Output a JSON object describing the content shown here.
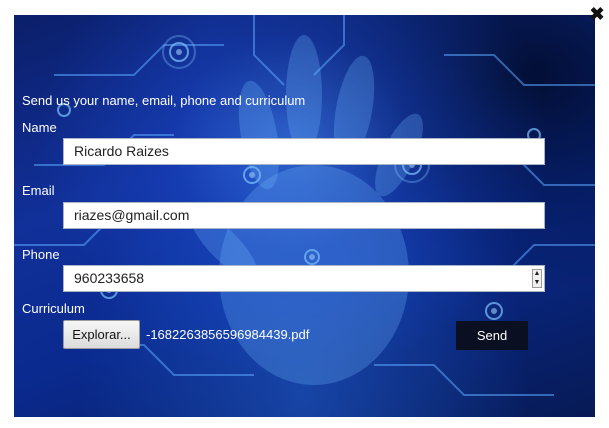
{
  "close_icon": "close-icon",
  "form": {
    "intro": "Send us your name, email, phone and curriculum",
    "name": {
      "label": "Name",
      "value": "Ricardo Raizes"
    },
    "email": {
      "label": "Email",
      "value": "riazes@gmail.com"
    },
    "phone": {
      "label": "Phone",
      "value": "960233658"
    },
    "curriculum": {
      "label": "Curriculum",
      "browse_label": "Explorar...",
      "file_name": "-168226385659698443​9.pdf"
    },
    "send_label": "Send"
  },
  "colors": {
    "background_dark": "#0b1f6a",
    "glow": "#468cff",
    "send_button": "#0a0f22"
  }
}
